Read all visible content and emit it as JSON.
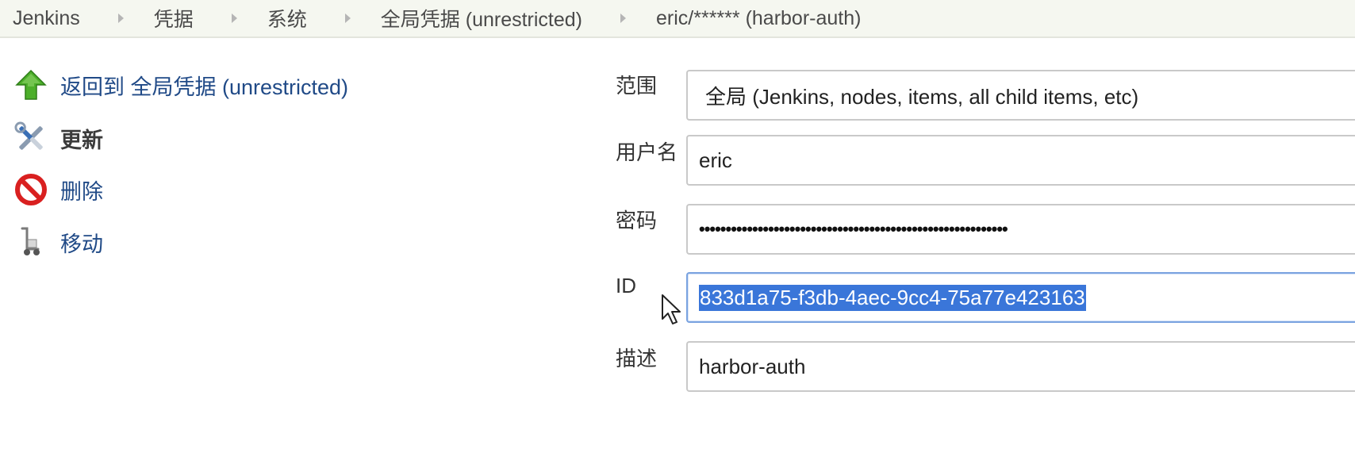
{
  "breadcrumb": {
    "items": [
      "Jenkins",
      "凭据",
      "系统",
      "全局凭据 (unrestricted)",
      "eric/****** (harbor-auth)"
    ]
  },
  "sidebar": {
    "back_label": "返回到 全局凭据 (unrestricted)",
    "update_label": "更新",
    "delete_label": "删除",
    "move_label": "移动"
  },
  "form": {
    "scope_label": "范围",
    "scope_value": "全局 (Jenkins, nodes, items, all child items, etc)",
    "username_label": "用户名",
    "username_value": "eric",
    "password_label": "密码",
    "password_value": "••••••••••••••••••••••••••••••••••••••••••••••••••••••••••",
    "id_label": "ID",
    "id_value": "833d1a75-f3db-4aec-9cc4-75a77e423163",
    "description_label": "描述",
    "description_value": "harbor-auth"
  },
  "colors": {
    "link": "#204a87",
    "selection": "#3a76d9",
    "breadcrumb_bg": "#f5f7f0"
  }
}
